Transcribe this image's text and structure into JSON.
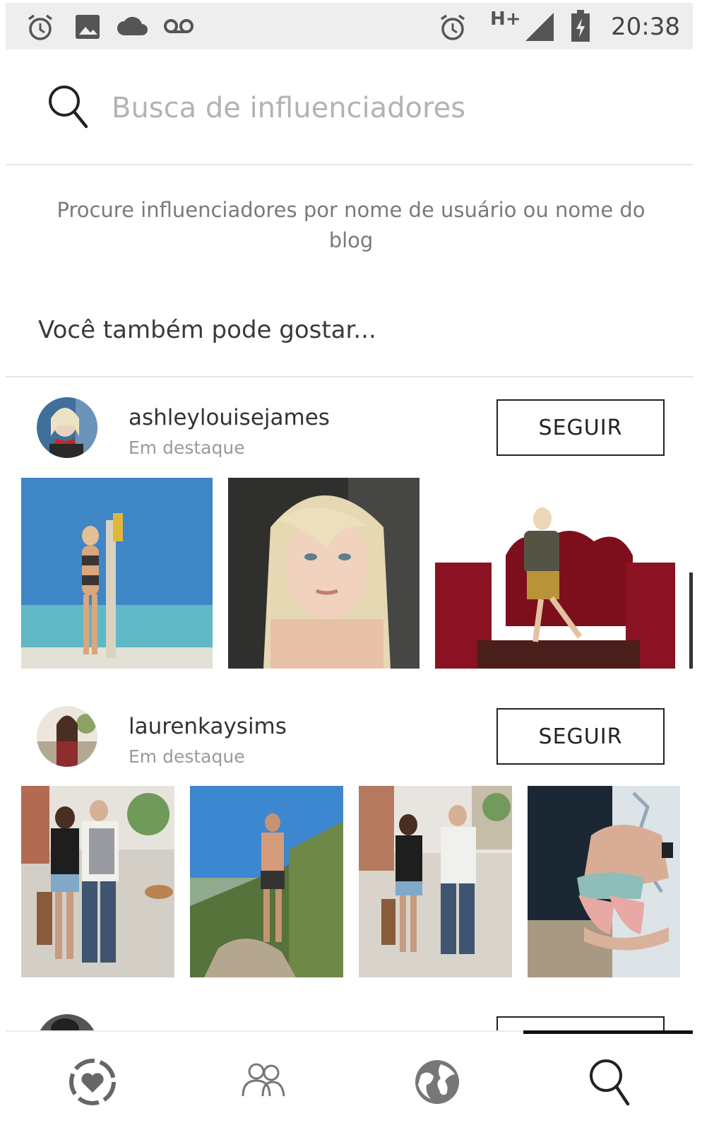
{
  "status_bar": {
    "time": "20:38",
    "network": "H+",
    "left_icons": [
      "alarm-icon",
      "image-icon",
      "cloud-icon",
      "voicemail-icon"
    ],
    "right_icons": [
      "alarm-icon",
      "signal-icon",
      "battery-charging-icon"
    ]
  },
  "search": {
    "placeholder": "Busca de influenciadores",
    "icon": "search-icon"
  },
  "hint": "Procure influenciadores por nome de usuário ou nome do blog",
  "section_title": "Você também pode gostar...",
  "influencers": [
    {
      "username": "ashleylouisejames",
      "subtitle": "Em destaque",
      "follow_label": "SEGUIR"
    },
    {
      "username": "laurenkaysims",
      "subtitle": "Em destaque",
      "follow_label": "SEGUIR"
    }
  ],
  "bottom_nav": {
    "items": [
      "heart-badge-icon",
      "people-icon",
      "globe-icon",
      "search-icon"
    ],
    "active": "search-icon"
  },
  "colors": {
    "status_bar_bg": "#eeeeee",
    "divider": "#e6e6e6",
    "text_primary": "#333333",
    "text_muted": "#9a9a9a",
    "button_border": "#222222"
  }
}
